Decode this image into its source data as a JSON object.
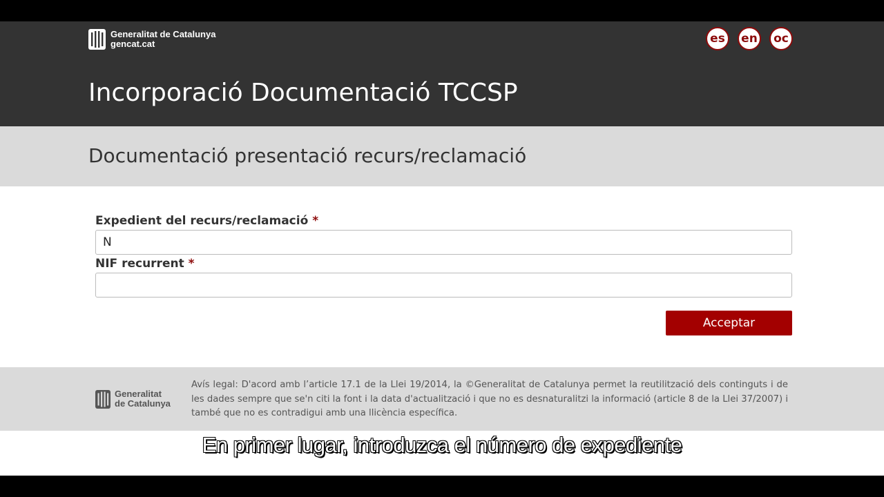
{
  "header": {
    "logo_line1": "Generalitat de Catalunya",
    "logo_line2": "gencat.cat",
    "languages": [
      "es",
      "en",
      "oc"
    ],
    "app_title": "Incorporació Documentació TCCSP"
  },
  "section": {
    "title": "Documentació presentació recurs/reclamació"
  },
  "form": {
    "expedient_label": "Expedient del recurs/reclamació",
    "expedient_value": "N",
    "nif_label": "NIF recurrent",
    "nif_value": "",
    "required_mark": "*",
    "accept_label": "Acceptar"
  },
  "footer": {
    "logo_line1": "Generalitat",
    "logo_line2": "de Catalunya",
    "legal_text": "Avís legal: D'acord amb l’article 17.1 de la Llei 19/2014, la ©Generalitat de Catalunya permet la reutilització dels continguts i de les dades sempre que se'n citi la font i la data d'actualització i que no es desnaturalitzi la informació (article 8 de la Llei 37/2007) i també que no es contradigui amb una llicència específica."
  },
  "subtitle": "En primer lugar, introduzca el número de expediente",
  "colors": {
    "header_bg": "#333333",
    "band_bg": "#dadada",
    "accent": "#a30000"
  },
  "icons": {
    "logo": "generalitat-stripes-icon"
  }
}
